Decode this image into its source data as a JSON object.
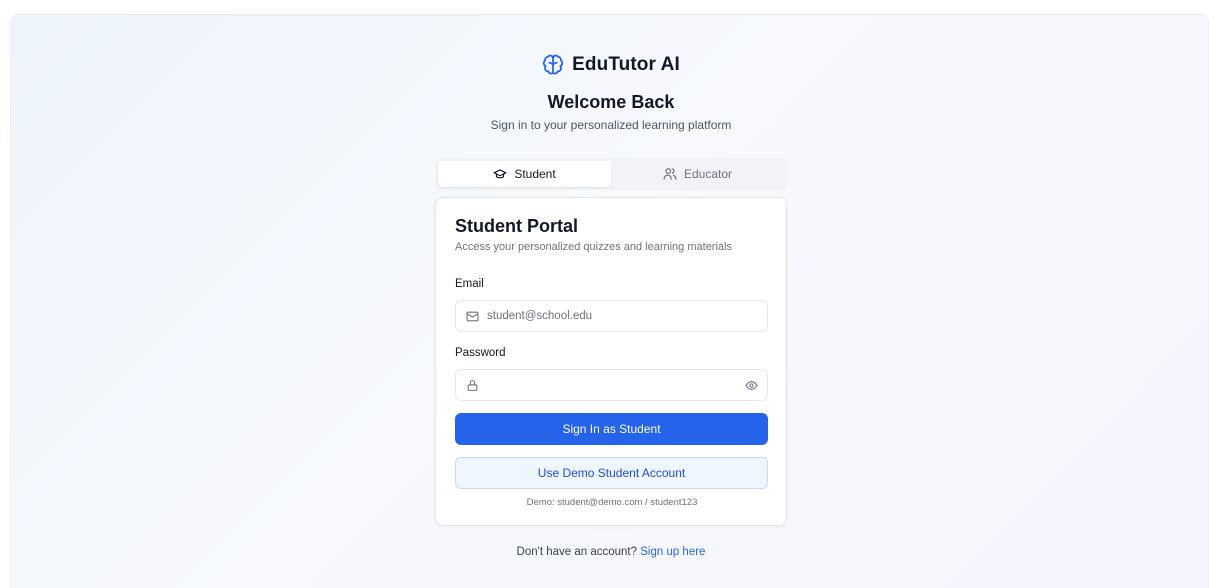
{
  "brand": {
    "name": "EduTutor AI",
    "logo_icon": "brain-icon",
    "accent_color": "#2563eb"
  },
  "header": {
    "title": "Welcome Back",
    "subtitle": "Sign in to your personalized learning platform"
  },
  "role_tabs": [
    {
      "label": "Student",
      "icon": "graduation-cap-icon",
      "active": true
    },
    {
      "label": "Educator",
      "icon": "users-icon",
      "active": false
    }
  ],
  "portal": {
    "title": "Student Portal",
    "description": "Access your personalized quizzes and learning materials",
    "email": {
      "label": "Email",
      "value": "",
      "placeholder": "student@school.edu",
      "icon": "mail-icon"
    },
    "password": {
      "label": "Password",
      "value": "",
      "placeholder": "",
      "icon": "lock-icon",
      "toggle_icon": "eye-icon"
    },
    "sign_in_label": "Sign In as Student",
    "demo_button_label": "Use Demo Student Account",
    "demo_hint": "Demo: student@demo.com / student123"
  },
  "footer": {
    "prompt": "Don't have an account?",
    "link_label": "Sign up here"
  }
}
